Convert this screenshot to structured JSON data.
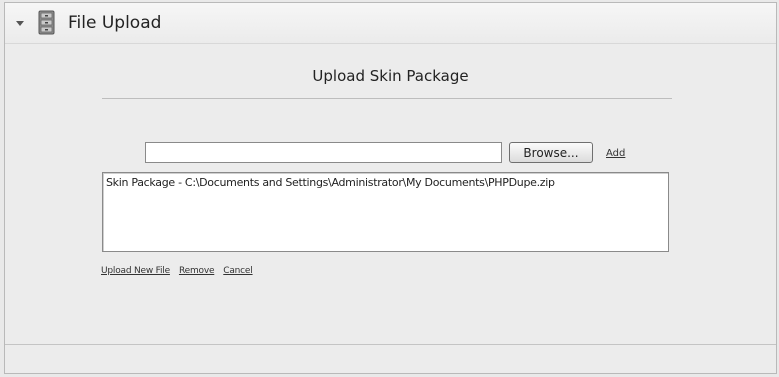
{
  "header": {
    "title": "File Upload",
    "icon": "file-cabinet-icon"
  },
  "panel": {
    "title": "Upload Skin Package"
  },
  "upload_form": {
    "file_input_value": "",
    "browse_label": "Browse...",
    "add_label": "Add"
  },
  "file_list": {
    "items": [
      "Skin Package - C:\\Documents and Settings\\Administrator\\My Documents\\PHPDupe.zip"
    ]
  },
  "actions": {
    "upload_new_file": "Upload New File",
    "remove": "Remove",
    "cancel": "Cancel"
  }
}
